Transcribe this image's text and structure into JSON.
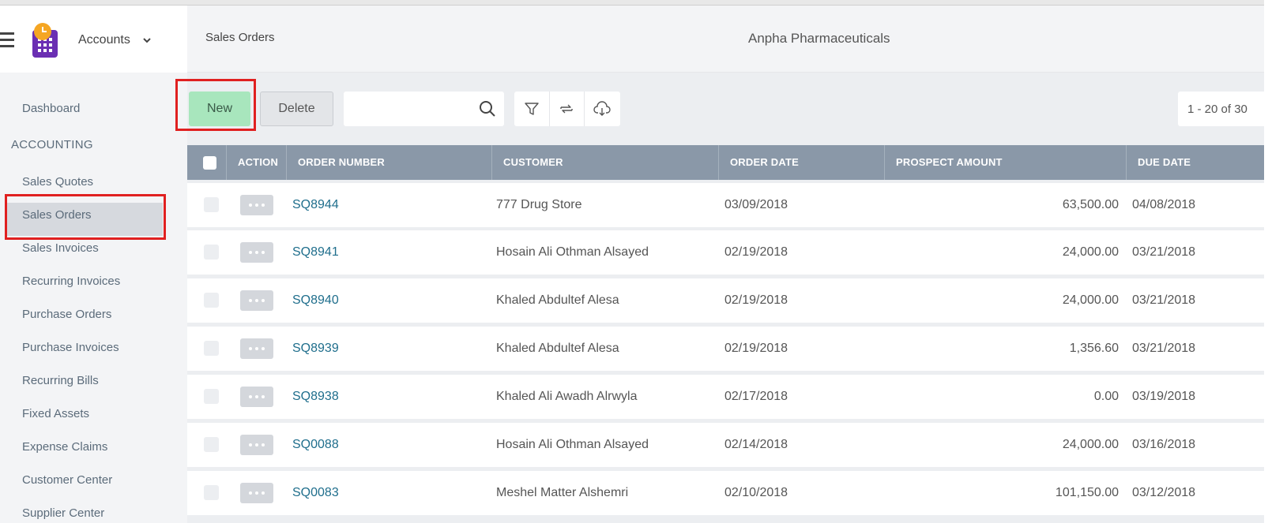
{
  "sidebar": {
    "app_name": "Accounts",
    "items": [
      {
        "label": "Dashboard"
      },
      {
        "label": "Sales Quotes"
      },
      {
        "label": "Sales Orders"
      },
      {
        "label": "Sales Invoices"
      },
      {
        "label": "Recurring Invoices"
      },
      {
        "label": "Purchase Orders"
      },
      {
        "label": "Purchase Invoices"
      },
      {
        "label": "Recurring Bills"
      },
      {
        "label": "Fixed Assets"
      },
      {
        "label": "Expense Claims"
      },
      {
        "label": "Customer Center"
      },
      {
        "label": "Supplier Center"
      }
    ],
    "section_label": "ACCOUNTING",
    "active_item": "Sales Orders"
  },
  "header": {
    "breadcrumb": "Sales Orders",
    "company": "Anpha Pharmaceuticals"
  },
  "toolbar": {
    "new_label": "New",
    "delete_label": "Delete",
    "search_placeholder": "",
    "pager": "1 - 20 of 30"
  },
  "table": {
    "columns": [
      "ACTION",
      "ORDER NUMBER",
      "CUSTOMER",
      "ORDER DATE",
      "PROSPECT AMOUNT",
      "DUE DATE"
    ],
    "rows": [
      {
        "order": "SQ8944",
        "customer": "777 Drug Store",
        "order_date": "03/09/2018",
        "amount": "63,500.00",
        "due_date": "04/08/2018"
      },
      {
        "order": "SQ8941",
        "customer": "Hosain Ali Othman Alsayed",
        "order_date": "02/19/2018",
        "amount": "24,000.00",
        "due_date": "03/21/2018"
      },
      {
        "order": "SQ8940",
        "customer": "Khaled Abdultef Alesa",
        "order_date": "02/19/2018",
        "amount": "24,000.00",
        "due_date": "03/21/2018"
      },
      {
        "order": "SQ8939",
        "customer": "Khaled Abdultef Alesa",
        "order_date": "02/19/2018",
        "amount": "1,356.60",
        "due_date": "03/21/2018"
      },
      {
        "order": "SQ8938",
        "customer": "Khaled Ali Awadh Alrwyla",
        "order_date": "02/17/2018",
        "amount": "0.00",
        "due_date": "03/19/2018"
      },
      {
        "order": "SQ0088",
        "customer": "Hosain Ali Othman Alsayed",
        "order_date": "02/14/2018",
        "amount": "24,000.00",
        "due_date": "03/16/2018"
      },
      {
        "order": "SQ0083",
        "customer": "Meshel Matter Alshemri",
        "order_date": "02/10/2018",
        "amount": "101,150.00",
        "due_date": "03/12/2018"
      }
    ]
  },
  "icons": {
    "menu": "hamburger-icon",
    "logo": "app-logo",
    "search": "search-icon",
    "filter": "filter-icon",
    "refresh": "refresh-icon",
    "download": "download-icon"
  },
  "colors": {
    "new_button": "#a8e6bd",
    "table_header": "#8a98a8",
    "link": "#1f6e8c",
    "highlight": "#e02020"
  }
}
